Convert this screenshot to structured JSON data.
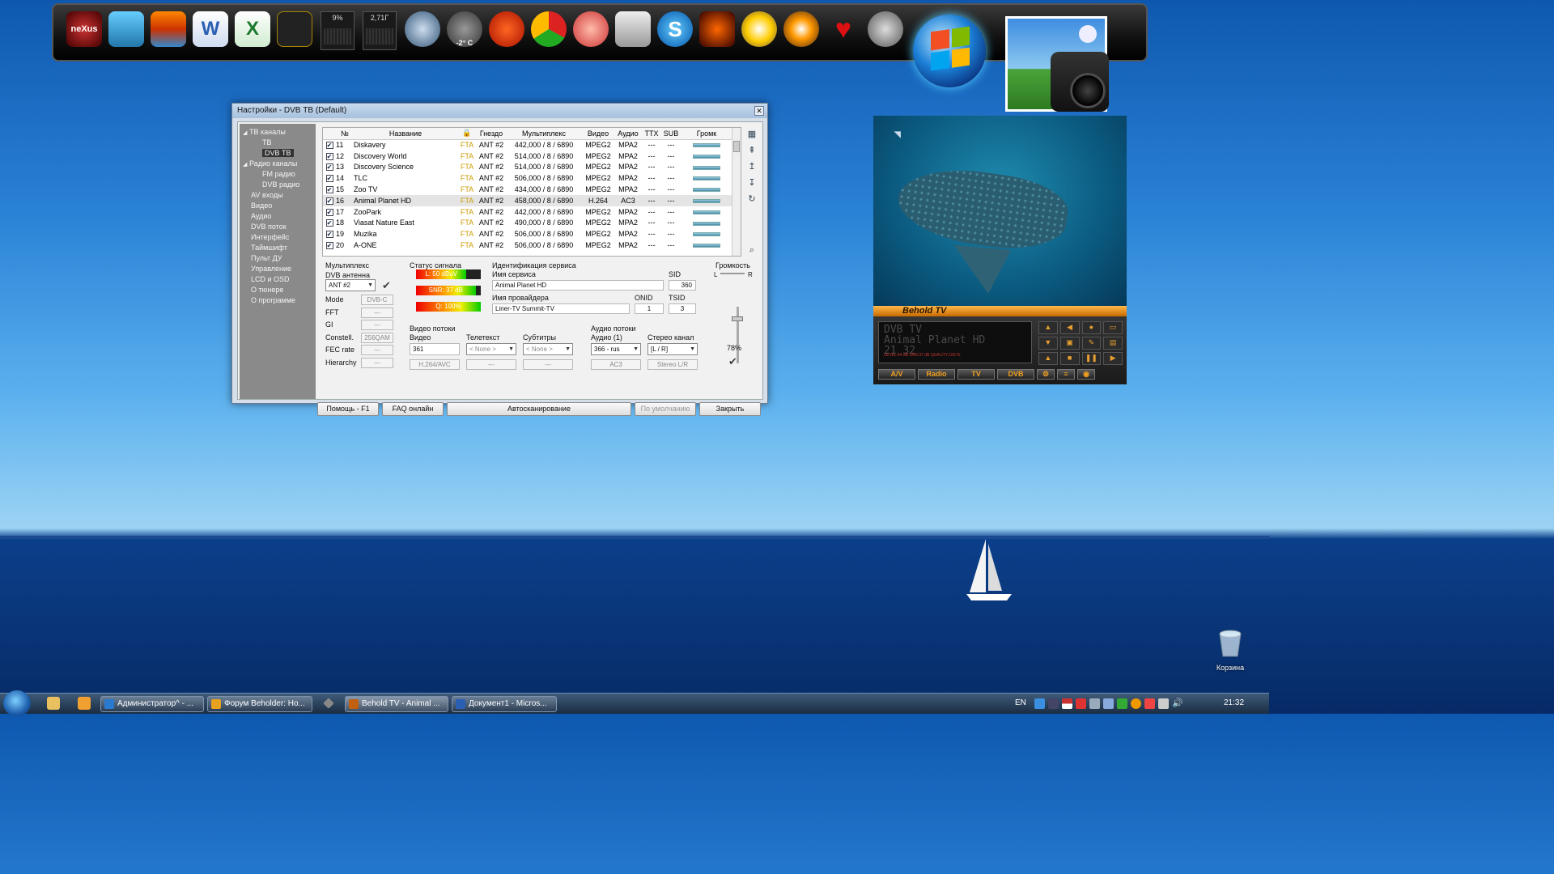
{
  "dock": {
    "nexus_label": "neXus",
    "cpu_meter": "9%",
    "mem_meter": "2,71Г",
    "weather_temp": "-2° C",
    "word_letter": "W",
    "excel_letter": "X",
    "skype_letter": "S"
  },
  "dialog": {
    "title": "Настройки - DVB ТВ (Default)",
    "tree": [
      {
        "label": "ТВ каналы",
        "level": 0,
        "expanded": true
      },
      {
        "label": "ТВ",
        "level": 2
      },
      {
        "label": "DVB ТВ",
        "level": 2,
        "selected": true
      },
      {
        "label": "Радио каналы",
        "level": 0,
        "expanded": true
      },
      {
        "label": "FM радио",
        "level": 2
      },
      {
        "label": "DVB радио",
        "level": 2
      },
      {
        "label": "AV входы",
        "level": 1
      },
      {
        "label": "Видео",
        "level": 1
      },
      {
        "label": "Аудио",
        "level": 1
      },
      {
        "label": "DVB поток",
        "level": 1
      },
      {
        "label": "Интерфейс",
        "level": 1
      },
      {
        "label": "Таймшифт",
        "level": 1
      },
      {
        "label": "Пульт ДУ",
        "level": 1
      },
      {
        "label": "Управление",
        "level": 1
      },
      {
        "label": "LCD и OSD",
        "level": 1
      },
      {
        "label": "О тюнере",
        "level": 1
      },
      {
        "label": "О программе",
        "level": 1
      }
    ],
    "columns": [
      "№",
      "Название",
      "🔒",
      "Гнездо",
      "Мультиплекс",
      "Видео",
      "Аудио",
      "TTX",
      "SUB",
      "Громк"
    ],
    "channels": [
      {
        "num": "11",
        "name": "Diskavery",
        "lock": "FTA",
        "socket": "ANT #2",
        "mux": "442,000 / 8 / 6890",
        "video": "MPEG2",
        "audio": "MPA2",
        "ttx": "---",
        "sub": "---"
      },
      {
        "num": "12",
        "name": "Discovery World",
        "lock": "FTA",
        "socket": "ANT #2",
        "mux": "514,000 / 8 / 6890",
        "video": "MPEG2",
        "audio": "MPA2",
        "ttx": "---",
        "sub": "---"
      },
      {
        "num": "13",
        "name": "Discovery Science",
        "lock": "FTA",
        "socket": "ANT #2",
        "mux": "514,000 / 8 / 6890",
        "video": "MPEG2",
        "audio": "MPA2",
        "ttx": "---",
        "sub": "---"
      },
      {
        "num": "14",
        "name": "TLC",
        "lock": "FTA",
        "socket": "ANT #2",
        "mux": "506,000 / 8 / 6890",
        "video": "MPEG2",
        "audio": "MPA2",
        "ttx": "---",
        "sub": "---"
      },
      {
        "num": "15",
        "name": "Zoo TV",
        "lock": "FTA",
        "socket": "ANT #2",
        "mux": "434,000 / 8 / 6890",
        "video": "MPEG2",
        "audio": "MPA2",
        "ttx": "---",
        "sub": "---"
      },
      {
        "num": "16",
        "name": "Animal Planet HD",
        "lock": "FTA",
        "socket": "ANT #2",
        "mux": "458,000 / 8 / 6890",
        "video": "H.264",
        "audio": "AC3",
        "ttx": "---",
        "sub": "---",
        "highlight": true
      },
      {
        "num": "17",
        "name": "ZooPark",
        "lock": "FTA",
        "socket": "ANT #2",
        "mux": "442,000 / 8 / 6890",
        "video": "MPEG2",
        "audio": "MPA2",
        "ttx": "---",
        "sub": "---"
      },
      {
        "num": "18",
        "name": "Viasat Nature East",
        "lock": "FTA",
        "socket": "ANT #2",
        "mux": "490,000 / 8 / 6890",
        "video": "MPEG2",
        "audio": "MPA2",
        "ttx": "---",
        "sub": "---"
      },
      {
        "num": "19",
        "name": "Muzika",
        "lock": "FTA",
        "socket": "ANT #2",
        "mux": "506,000 / 8 / 6890",
        "video": "MPEG2",
        "audio": "MPA2",
        "ttx": "---",
        "sub": "---"
      },
      {
        "num": "20",
        "name": "A-ONE",
        "lock": "FTA",
        "socket": "ANT #2",
        "mux": "506,000 / 8 / 6890",
        "video": "MPEG2",
        "audio": "MPA2",
        "ttx": "---",
        "sub": "---"
      }
    ],
    "mux": {
      "header": "Мультиплекс",
      "antenna_label": "DVB антенна",
      "antenna_value": "ANT #2",
      "rows": [
        {
          "label": "Mode",
          "value": "DVB-C"
        },
        {
          "label": "FFT",
          "value": "---"
        },
        {
          "label": "GI",
          "value": "---"
        },
        {
          "label": "Constell.",
          "value": "256QAM"
        },
        {
          "label": "FEC rate",
          "value": "---"
        },
        {
          "label": "Hierarchy",
          "value": "---"
        }
      ]
    },
    "signal": {
      "header": "Статус сигнала",
      "level_text": "L: 50 dBuV",
      "snr_text": "SNR: 37 dB",
      "quality_text": "Q: 100%",
      "level_fraction": 0.78,
      "snr_fraction": 0.92,
      "quality_fraction": 1.0
    },
    "service": {
      "header": "Идентификация сервиса",
      "name_label": "Имя сервиса",
      "name_value": "Animal Planet HD",
      "sid_label": "SID",
      "sid_value": "360",
      "provider_label": "Имя провайдера",
      "provider_value": "Liner-TV  Summit-TV",
      "onid_label": "ONID",
      "onid_value": "1",
      "tsid_label": "TSID",
      "tsid_value": "3"
    },
    "video_streams": {
      "header": "Видео потоки",
      "video_label": "Видео",
      "video_value": "361",
      "video_codec": "H.264/AVC",
      "teletext_label": "Телетекст",
      "teletext_value": "< None >",
      "teletext_info": "---",
      "subs_label": "Субтитры",
      "subs_value": "< None >",
      "subs_info": "---"
    },
    "audio_streams": {
      "header": "Аудио потоки",
      "audio_label": "Аудио (1)",
      "audio_value": "366 - rus",
      "audio_codec": "AC3",
      "stereo_label": "Стерео канал",
      "stereo_value": "[L / R]",
      "stereo_info": "Stereo L/R"
    },
    "volume": {
      "header": "Громкость",
      "left": "L",
      "right": "R",
      "value_text": "78%",
      "level": 0.78
    },
    "buttons": {
      "help": "Помощь - F1",
      "faq": "FAQ онлайн",
      "autoscan": "Автосканирование",
      "defaults": "По умолчанию",
      "close": "Закрыть"
    }
  },
  "player": {
    "title": "Behold TV",
    "lcd_line1": "DVB TV",
    "lcd_line2": "Animal Planet HD",
    "lcd_line3": "21 32",
    "lcd_stats": "LEVEL:54 dB    SNR:37 dB    QUALITY:100 %",
    "modes": [
      "A/V",
      "Radio",
      "TV",
      "DVB"
    ]
  },
  "desktop": {
    "recycle_bin": "Корзина"
  },
  "taskbar": {
    "tasks": [
      {
        "label": "Администратор^ - ...",
        "color": "#2a7ad0"
      },
      {
        "label": "Форум Beholder: Но...",
        "color": "#e8a020"
      },
      {
        "label": "Behold TV - Animal ...",
        "color": "#c06010",
        "active": true
      },
      {
        "label": "Документ1 - Micros...",
        "color": "#2b5fb4"
      }
    ],
    "lang": "EN",
    "clock": "21:32"
  }
}
